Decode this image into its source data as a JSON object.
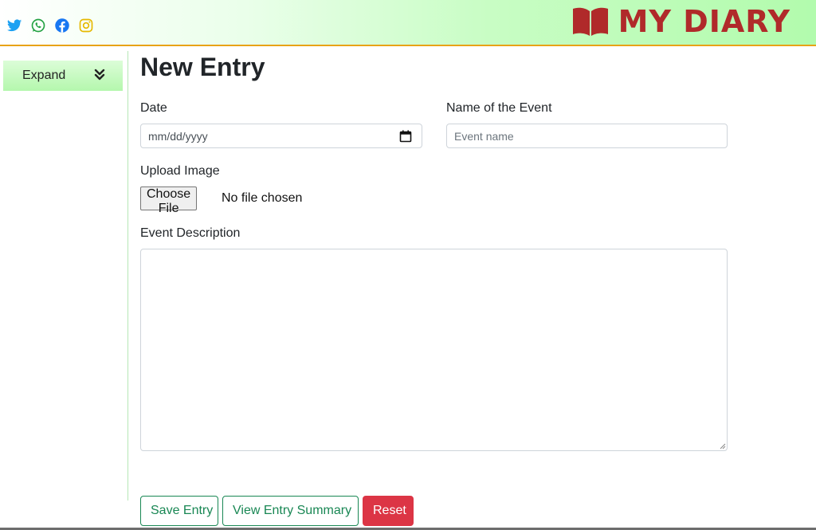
{
  "header": {
    "brand_title": "MY DIARY",
    "social_icons": [
      "twitter-icon",
      "whatsapp-icon",
      "facebook-icon",
      "instagram-icon"
    ],
    "colors": {
      "twitter": "#1da1f2",
      "whatsapp": "#25a244",
      "facebook": "#1877f2",
      "instagram": "#e6b800",
      "brand": "#b02a2a",
      "border": "#e8a317"
    }
  },
  "sidebar": {
    "expand_label": "Expand",
    "expand_icon": "chevron-double-down-icon"
  },
  "form": {
    "title": "New Entry",
    "date_label": "Date",
    "date_format": "mm/dd/yyyy",
    "event_label": "Name of the Event",
    "event_placeholder": "Event name",
    "upload_label": "Upload Image",
    "choose_file_label": "Choose File",
    "file_status": "No file chosen",
    "description_label": "Event Description"
  },
  "actions": {
    "save_label": "Save Entry",
    "summary_label": "View Entry Summary",
    "reset_label": "Reset",
    "colors": {
      "outline": "#198754",
      "danger": "#dc3545"
    }
  }
}
